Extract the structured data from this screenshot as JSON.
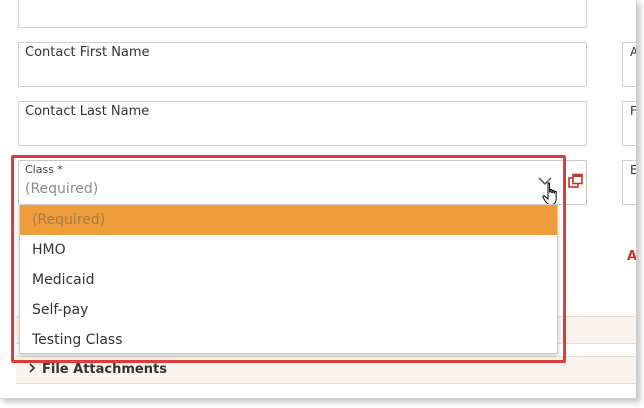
{
  "form": {
    "contact_first_name_label": "Contact First Name",
    "contact_last_name_label": "Contact Last Name",
    "class_label": "Class *",
    "class_value": "(Required)"
  },
  "dropdown": {
    "options": [
      "(Required)",
      "HMO",
      "Medicaid",
      "Self-pay",
      "Testing Class"
    ],
    "selected_index": 0
  },
  "right_column": {
    "letters": [
      "A",
      "F",
      "E"
    ],
    "section_letter": "A"
  },
  "sections": {
    "file_attachments_label": "File Attachments"
  },
  "colors": {
    "highlight_border": "#e23a3a",
    "selected_option_bg": "#ee9d3a",
    "popout_icon": "#c0392b",
    "section_bar_bg": "#fbf3ee"
  },
  "icons": {
    "chevron": "chevron-down-icon",
    "cursor": "hand-pointer-icon",
    "popout": "popout-window-icon",
    "caret": "chevron-right-icon"
  }
}
